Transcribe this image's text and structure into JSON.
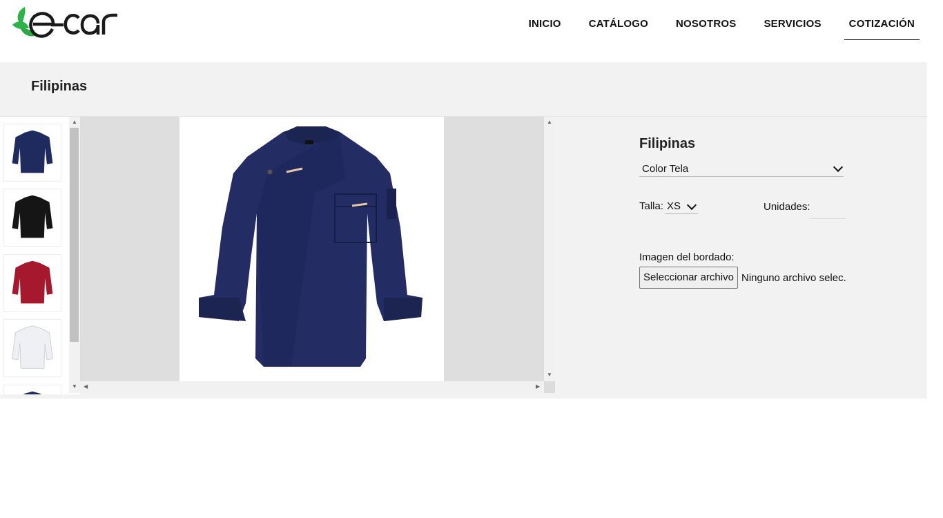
{
  "brand": {
    "logo_text": "e-car",
    "leaf_color": "#2db34a",
    "text_color": "#1a1a1a"
  },
  "nav": {
    "items": [
      "INICIO",
      "CATÁLOGO",
      "NOSOTROS",
      "SERVICIOS",
      "COTIZACIÓN"
    ],
    "active": "COTIZACIÓN"
  },
  "page": {
    "title": "Filipinas"
  },
  "gallery": {
    "thumbnails": [
      {
        "color_name": "navy",
        "color": "#1f2a5e"
      },
      {
        "color_name": "black",
        "color": "#151515"
      },
      {
        "color_name": "red",
        "color": "#a5182e"
      },
      {
        "color_name": "white",
        "color": "#f2f2f4"
      },
      {
        "color_name": "navy",
        "color": "#1f2a5e"
      }
    ],
    "main_image_color": "#232c63"
  },
  "form": {
    "product_name": "Filipinas",
    "color_select": {
      "value": "Color Tela"
    },
    "size_label": "Talla:",
    "size_select": {
      "value": "XS"
    },
    "units_label": "Unidades:",
    "units_value": "",
    "embroidery_label": "Imagen del bordado:",
    "file_button_label": "Seleccionar archivo",
    "file_status": "Ninguno archivo selec."
  }
}
